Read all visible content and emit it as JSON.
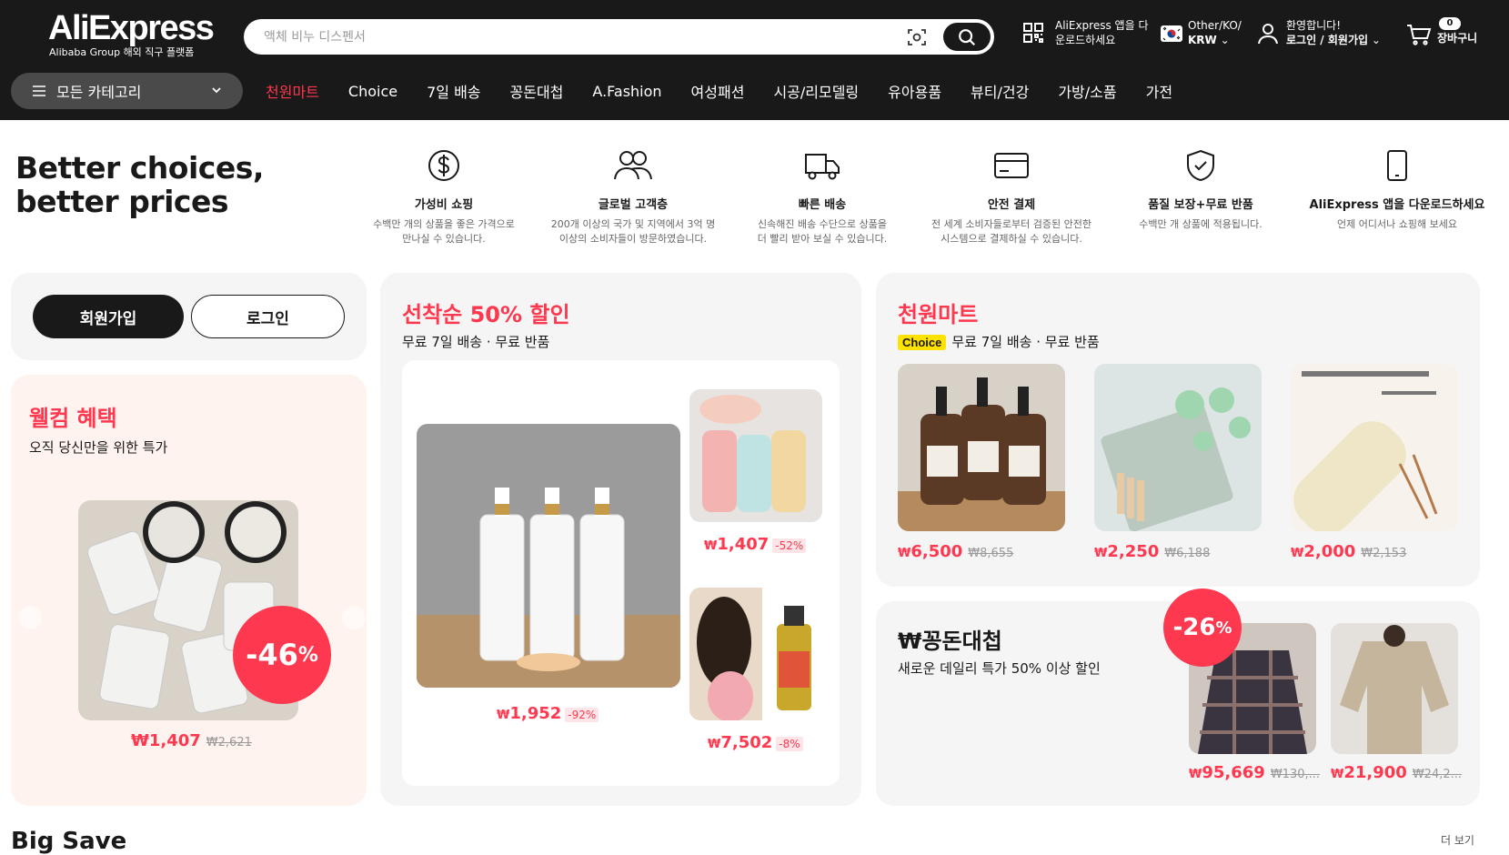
{
  "header": {
    "logo": "AliExpress",
    "logo_sub": "Alibaba Group 해외 직구 플랫폼",
    "search_placeholder": "액체 비누 디스펜서",
    "app_line1": "AliExpress 앱을 다",
    "app_line2": "운로드하세요",
    "lang_line1": "Other/KO/",
    "lang_line2": "KRW",
    "acct_line1": "환영합니다!",
    "acct_line2": "로그인 / 회원가입",
    "cart_count": "0",
    "cart_label": "장바구니"
  },
  "nav": {
    "all_categories": "모든 카테고리",
    "links": [
      "천원마트",
      "Choice",
      "7일 배송",
      "꽁돈대첩",
      "A.Fashion",
      "여성패션",
      "시공/리모델링",
      "유아용품",
      "뷰티/건강",
      "가방/소품",
      "가전"
    ]
  },
  "tagline": {
    "line1": "Better choices,",
    "line2": "better prices"
  },
  "benefits": [
    {
      "icon": "dollar-icon",
      "title": "가성비 쇼핑",
      "desc1": "수백만 개의 상품을 좋은 가격으로",
      "desc2": "만나실 수 있습니다."
    },
    {
      "icon": "users-icon",
      "title": "글로벌 고객층",
      "desc1": "200개 이상의 국가 및 지역에서 3억 명",
      "desc2": "이상의 소비자들이 방문하였습니다."
    },
    {
      "icon": "truck-icon",
      "title": "빠른 배송",
      "desc1": "신속해진 배송 수단으로 상품을",
      "desc2": "더 빨리 받아 보실 수 있습니다."
    },
    {
      "icon": "card-icon",
      "title": "안전 결제",
      "desc1": "전 세계 소비자들로부터 검증된 안전한",
      "desc2": "시스템으로 결제하실 수 있습니다."
    },
    {
      "icon": "shield-icon",
      "title": "품질 보장+무료 반품",
      "desc1": "수백만 개 상품에 적용됩니다.",
      "desc2": ""
    },
    {
      "icon": "phone-icon",
      "title": "AliExpress 앱을 다운로드하세요",
      "desc1": "언제 어디서나 쇼핑해 보세요",
      "desc2": ""
    }
  ],
  "login": {
    "join": "회원가입",
    "login": "로그인"
  },
  "welcome": {
    "title": "웰컴 혜택",
    "subtitle": "오직 당신만을 위한 특가",
    "discount": "-46",
    "price": "1,407",
    "orig": "₩2,621"
  },
  "flash": {
    "title": "선착순 50% 할인",
    "subtitle": "무료 7일 배송 · 무료 반품",
    "items": [
      {
        "price": "1,952",
        "pct": "-92%"
      },
      {
        "price": "1,407",
        "pct": "-52%"
      },
      {
        "price": "7,502",
        "pct": "-8%"
      }
    ]
  },
  "mart": {
    "title": "천원마트",
    "choice": "Choice",
    "subtitle": "무료 7일 배송 · 무료 반품",
    "items": [
      {
        "price": "6,500",
        "orig": "₩8,655"
      },
      {
        "price": "2,250",
        "orig": "₩6,188"
      },
      {
        "price": "2,000",
        "orig": "₩2,153"
      }
    ]
  },
  "deal": {
    "title": "₩꽁돈대첩",
    "subtitle": "새로운 데일리 특가 50% 이상 할인",
    "badge": "-26",
    "items": [
      {
        "price": "95,669",
        "orig": "₩130,..."
      },
      {
        "price": "21,900",
        "orig": "₩24,2..."
      }
    ]
  },
  "footer": {
    "bigsave": "Big Save",
    "more": "더 보기"
  }
}
